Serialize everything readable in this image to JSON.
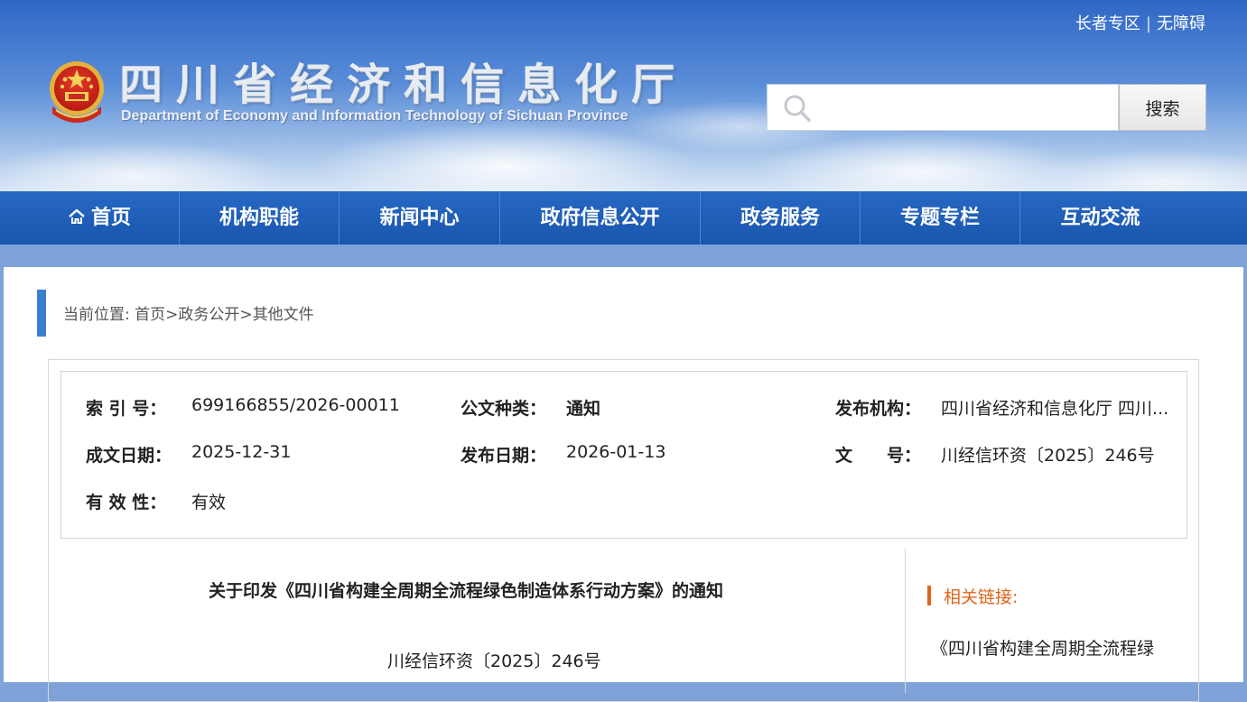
{
  "top_links": {
    "elderly": "长者专区",
    "separator": "|",
    "accessibility": "无障碍"
  },
  "site": {
    "title": "四川省经济和信息化厅",
    "subtitle": "Department of Economy and Information Technology of Sichuan Province"
  },
  "search": {
    "placeholder": "",
    "button_label": "搜索"
  },
  "nav": {
    "items": [
      "首页",
      "机构职能",
      "新闻中心",
      "政府信息公开",
      "政务服务",
      "专题专栏",
      "互动交流"
    ]
  },
  "breadcrumb": {
    "text": "当前位置: 首页>政务公开>其他文件"
  },
  "meta": {
    "index_label": "索 引 号：",
    "index_value": "699166855/2026-00011",
    "doctype_label": "公文种类：",
    "doctype_value": "通知",
    "publisher_label": "发布机构：",
    "publisher_value": "四川省经济和信息化厅 四川...",
    "written_date_label": "成文日期：",
    "written_date_value": "2025-12-31",
    "publish_date_label": "发布日期：",
    "publish_date_value": "2026-01-13",
    "docno_label": "文　　号：",
    "docno_value": "川经信环资〔2025〕246号",
    "validity_label": "有 效 性：",
    "validity_value": "有效"
  },
  "document": {
    "title": "关于印发《四川省构建全周期全流程绿色制造体系行动方案》的通知",
    "number": "川经信环资〔2025〕246号"
  },
  "related": {
    "title": "相关链接:",
    "link": "《四川省构建全周期全流程绿"
  },
  "colors": {
    "nav_blue": "#1a56ad",
    "accent_orange": "#e0641a",
    "breadcrumb_bar": "#3a7fcc"
  }
}
